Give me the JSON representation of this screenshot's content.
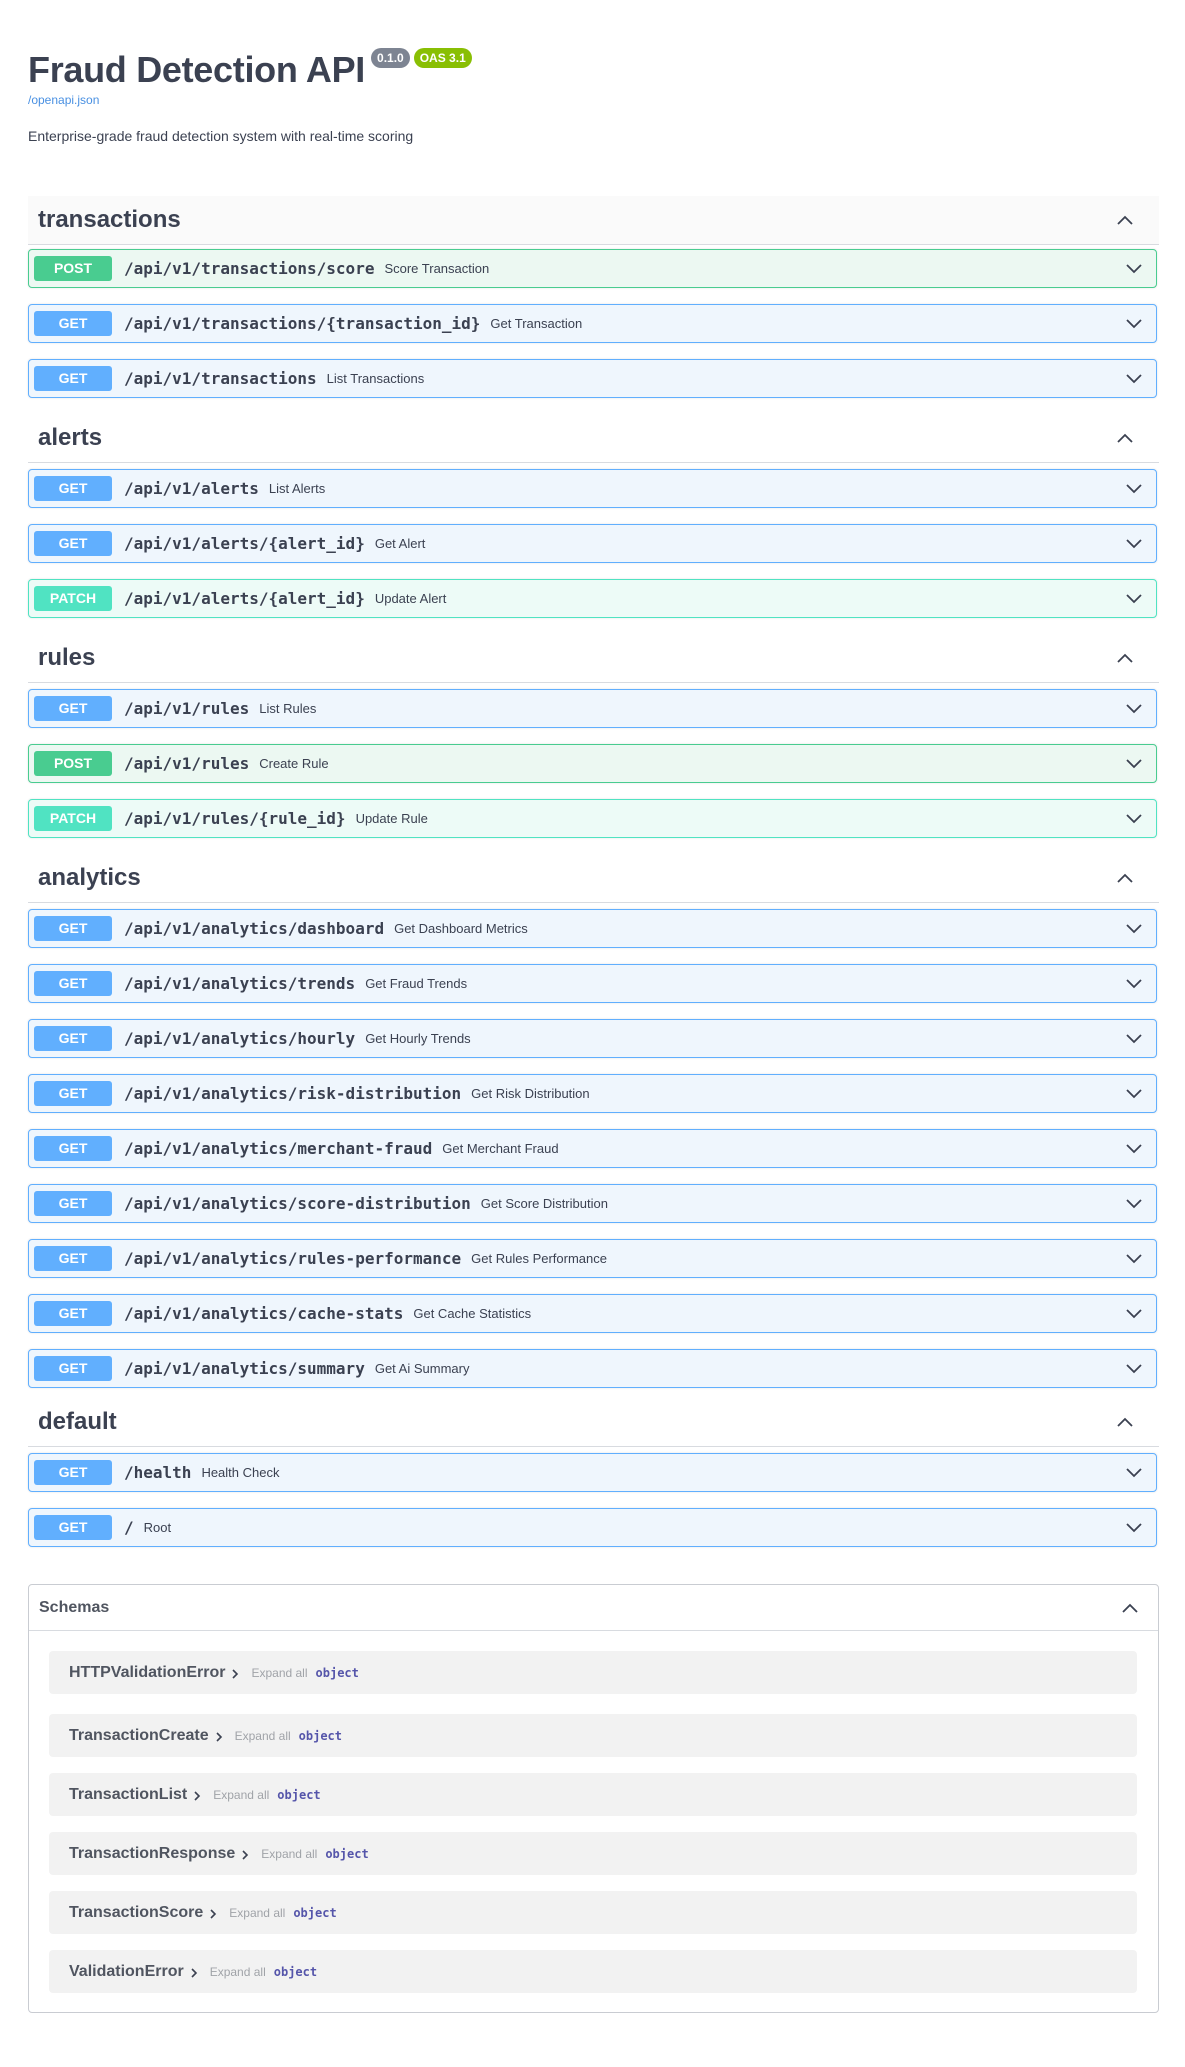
{
  "header": {
    "title": "Fraud Detection API",
    "version_badge": "0.1.0",
    "oas_badge": "OAS 3.1",
    "spec_link": "/openapi.json",
    "description": "Enterprise-grade fraud detection system with real-time scoring"
  },
  "tags": {
    "transactions": {
      "name": "transactions",
      "ops": [
        {
          "method": "POST",
          "path": "/api/v1/transactions/score",
          "summary": "Score Transaction"
        },
        {
          "method": "GET",
          "path": "/api/v1/transactions/{transaction_id}",
          "summary": "Get Transaction"
        },
        {
          "method": "GET",
          "path": "/api/v1/transactions",
          "summary": "List Transactions"
        }
      ]
    },
    "alerts": {
      "name": "alerts",
      "ops": [
        {
          "method": "GET",
          "path": "/api/v1/alerts",
          "summary": "List Alerts"
        },
        {
          "method": "GET",
          "path": "/api/v1/alerts/{alert_id}",
          "summary": "Get Alert"
        },
        {
          "method": "PATCH",
          "path": "/api/v1/alerts/{alert_id}",
          "summary": "Update Alert"
        }
      ]
    },
    "rules": {
      "name": "rules",
      "ops": [
        {
          "method": "GET",
          "path": "/api/v1/rules",
          "summary": "List Rules"
        },
        {
          "method": "POST",
          "path": "/api/v1/rules",
          "summary": "Create Rule"
        },
        {
          "method": "PATCH",
          "path": "/api/v1/rules/{rule_id}",
          "summary": "Update Rule"
        }
      ]
    },
    "analytics": {
      "name": "analytics",
      "ops": [
        {
          "method": "GET",
          "path": "/api/v1/analytics/dashboard",
          "summary": "Get Dashboard Metrics"
        },
        {
          "method": "GET",
          "path": "/api/v1/analytics/trends",
          "summary": "Get Fraud Trends"
        },
        {
          "method": "GET",
          "path": "/api/v1/analytics/hourly",
          "summary": "Get Hourly Trends"
        },
        {
          "method": "GET",
          "path": "/api/v1/analytics/risk-distribution",
          "summary": "Get Risk Distribution"
        },
        {
          "method": "GET",
          "path": "/api/v1/analytics/merchant-fraud",
          "summary": "Get Merchant Fraud"
        },
        {
          "method": "GET",
          "path": "/api/v1/analytics/score-distribution",
          "summary": "Get Score Distribution"
        },
        {
          "method": "GET",
          "path": "/api/v1/analytics/rules-performance",
          "summary": "Get Rules Performance"
        },
        {
          "method": "GET",
          "path": "/api/v1/analytics/cache-stats",
          "summary": "Get Cache Statistics"
        },
        {
          "method": "GET",
          "path": "/api/v1/analytics/summary",
          "summary": "Get Ai Summary"
        }
      ]
    },
    "default": {
      "name": "default",
      "ops": [
        {
          "method": "GET",
          "path": "/health",
          "summary": "Health Check"
        },
        {
          "method": "GET",
          "path": "/",
          "summary": "Root"
        }
      ]
    }
  },
  "schemas": {
    "title": "Schemas",
    "expand_label": "Expand all",
    "type_label": "object",
    "models": [
      "HTTPValidationError",
      "TransactionCreate",
      "TransactionList",
      "TransactionResponse",
      "TransactionScore",
      "ValidationError"
    ]
  },
  "colors": {
    "get": "#61affe",
    "post": "#49cc90",
    "patch": "#50e3c2",
    "text": "#3b4151"
  }
}
